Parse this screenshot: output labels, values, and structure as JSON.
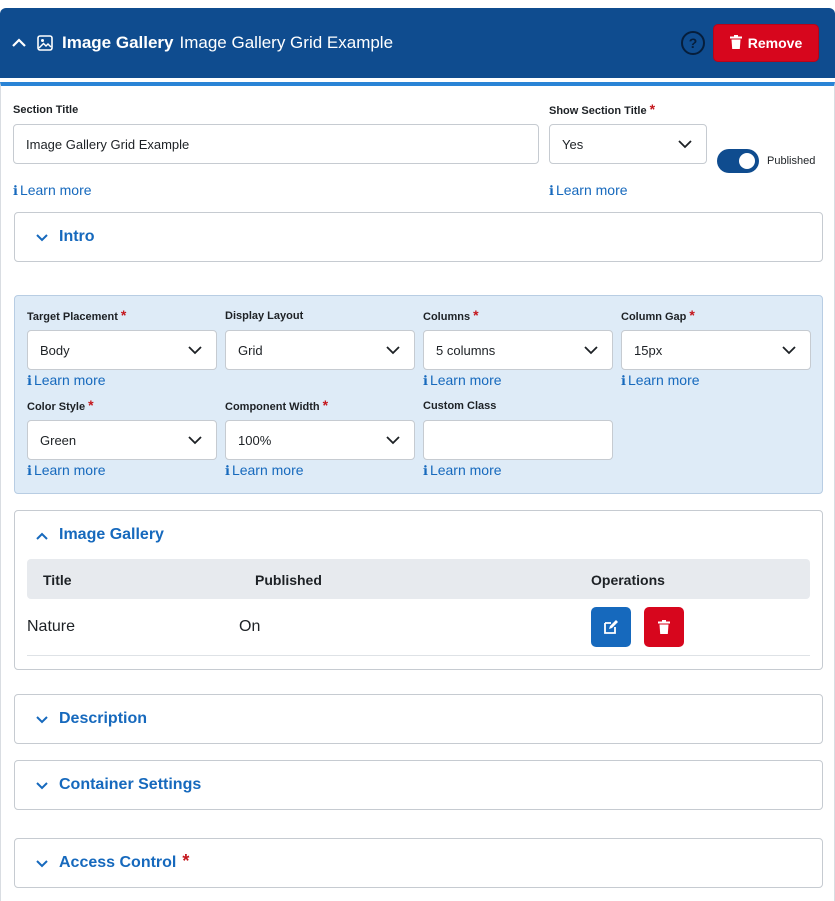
{
  "header": {
    "component_type": "Image Gallery",
    "section_name": "Image Gallery Grid Example",
    "help_label": "?",
    "remove_label": "Remove",
    "collapse_icon": "chevron-up-icon",
    "type_icon": "image-icon",
    "remove_icon": "trash-icon",
    "colors": {
      "header_bg": "#0f4c8f",
      "remove_bg": "#d7061d",
      "accent": "#1669bd"
    }
  },
  "settings": {
    "section_title_label": "Section Title",
    "section_title_value": "Image Gallery Grid Example",
    "show_section_title_label": "Show Section Title",
    "show_section_title_value": "Yes",
    "published_label": "Published",
    "published_on": true,
    "learn_more": "Learn more",
    "info_glyph": "ℹ"
  },
  "intro": {
    "title": "Intro"
  },
  "options": {
    "target_placement_label": "Target Placement",
    "target_placement_value": "Body",
    "display_layout_label": "Display Layout",
    "display_layout_value": "Grid",
    "columns_label": "Columns",
    "columns_value": "5 columns",
    "column_gap_label": "Column Gap",
    "column_gap_value": "15px",
    "color_style_label": "Color Style",
    "color_style_value": "Green",
    "component_width_label": "Component Width",
    "component_width_value": "100%",
    "custom_class_label": "Custom Class",
    "custom_class_value": "",
    "required_mark": "*"
  },
  "gallery": {
    "title": "Image Gallery",
    "columns": [
      "Title",
      "Published",
      "Operations"
    ],
    "rows": [
      {
        "title": "Nature",
        "published": "On"
      }
    ]
  },
  "description": {
    "title": "Description"
  },
  "container_settings": {
    "title": "Container Settings"
  },
  "access_control": {
    "title": "Access Control",
    "required_mark": "*"
  }
}
